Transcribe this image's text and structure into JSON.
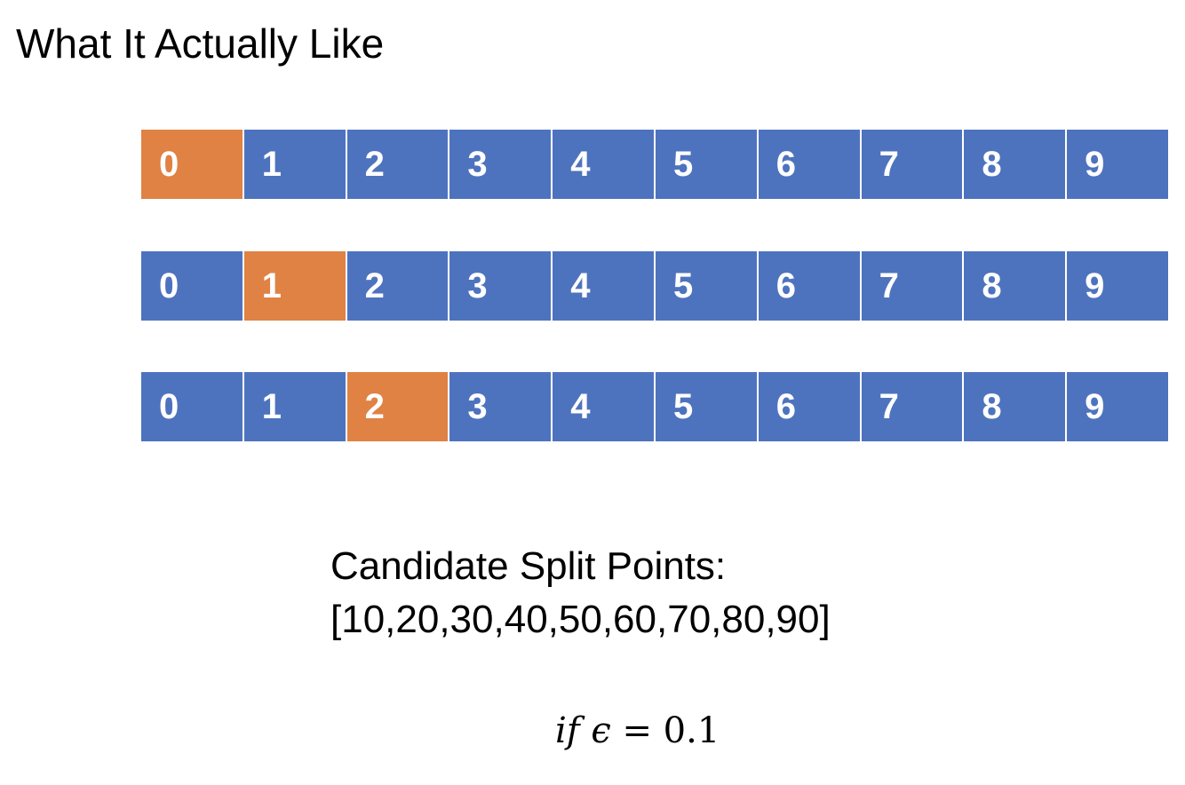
{
  "title": "What It Actually Like",
  "colors": {
    "cell": "#4E73BE",
    "highlight": "#DF8244"
  },
  "rows": [
    {
      "cells": [
        "0",
        "1",
        "2",
        "3",
        "4",
        "5",
        "6",
        "7",
        "8",
        "9"
      ],
      "highlighted": 0
    },
    {
      "cells": [
        "0",
        "1",
        "2",
        "3",
        "4",
        "5",
        "6",
        "7",
        "8",
        "9"
      ],
      "highlighted": 1
    },
    {
      "cells": [
        "0",
        "1",
        "2",
        "3",
        "4",
        "5",
        "6",
        "7",
        "8",
        "9"
      ],
      "highlighted": 2
    }
  ],
  "candidates": {
    "label": "Candidate Split Points:",
    "values": "[10,20,30,40,50,60,70,80,90]"
  },
  "equation": {
    "lhs": "if ϵ",
    "rhs": "= 0.1"
  }
}
